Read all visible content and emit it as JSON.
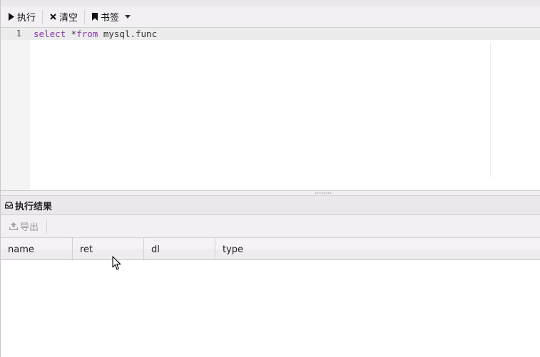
{
  "toolbar": {
    "run_label": "执行",
    "clear_label": "清空",
    "bookmark_label": "书签"
  },
  "editor": {
    "line_number": "1",
    "code": {
      "kw_select": "select",
      "star": " *",
      "kw_from": "from",
      "table": " mysql.func"
    }
  },
  "results": {
    "title": "执行结果",
    "export_label": "导出",
    "columns": [
      "name",
      "ret",
      "dl",
      "type"
    ]
  },
  "colors": {
    "keyword": "#8a39a8",
    "disabled_text": "#9a9a9a"
  }
}
